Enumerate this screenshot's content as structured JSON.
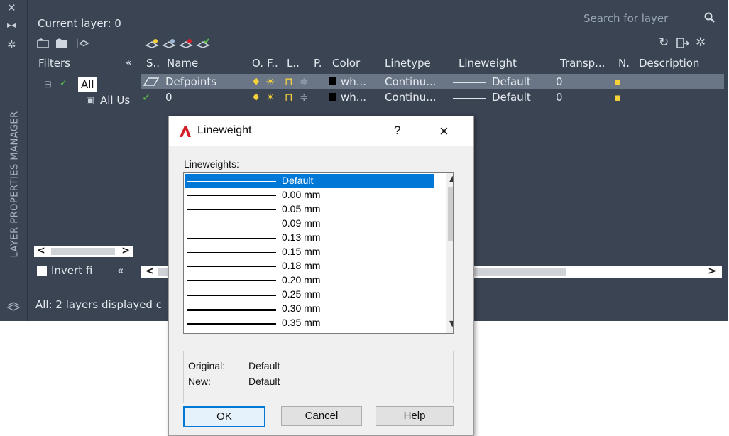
{
  "palette": {
    "current_layer": "Current layer: 0",
    "search_placeholder": "Search for layer",
    "side_title": "LAYER PROPERTIES MANAGER",
    "filters_label": "Filters",
    "filters_collapse": "«",
    "tree": {
      "all": "All",
      "all_used": "All Us"
    },
    "invert_label": "Invert fi",
    "status": "All: 2 layers displayed c"
  },
  "columns": [
    "S..",
    "Name",
    "O.",
    "F..",
    "L..",
    "P.",
    "Color",
    "Linetype",
    "Lineweight",
    "Transp...",
    "N.",
    "Description"
  ],
  "layers": [
    {
      "name": "Defpoints",
      "color": "wh...",
      "linetype": "Continu...",
      "lineweight": "Default",
      "transparency": "0",
      "selected": true
    },
    {
      "name": "0",
      "color": "wh...",
      "linetype": "Continu...",
      "lineweight": "Default",
      "transparency": "0",
      "selected": false
    }
  ],
  "dialog": {
    "title": "Lineweight",
    "help_glyph": "?",
    "close_glyph": "×",
    "list_caption": "Lineweights:",
    "items": [
      {
        "label": "Default",
        "weight": 1,
        "selected": true
      },
      {
        "label": "0.00 mm",
        "weight": 1
      },
      {
        "label": "0.05 mm",
        "weight": 1
      },
      {
        "label": "0.09 mm",
        "weight": 1
      },
      {
        "label": "0.13 mm",
        "weight": 1
      },
      {
        "label": "0.15 mm",
        "weight": 1
      },
      {
        "label": "0.18 mm",
        "weight": 1
      },
      {
        "label": "0.20 mm",
        "weight": 1
      },
      {
        "label": "0.25 mm",
        "weight": 2
      },
      {
        "label": "0.30 mm",
        "weight": 3
      },
      {
        "label": "0.35 mm",
        "weight": 3
      }
    ],
    "original_label": "Original:",
    "original_value": "Default",
    "new_label": "New:",
    "new_value": "Default",
    "ok_label": "OK",
    "cancel_label": "Cancel",
    "help_label": "Help"
  },
  "colors": {
    "panel_bg": "#3b4453",
    "selection_row": "#6a7686",
    "dialog_selection": "#0078d7",
    "check_green": "#5cc24a",
    "bulb_yellow": "#f5d23a",
    "logo_red": "#d3202a"
  }
}
